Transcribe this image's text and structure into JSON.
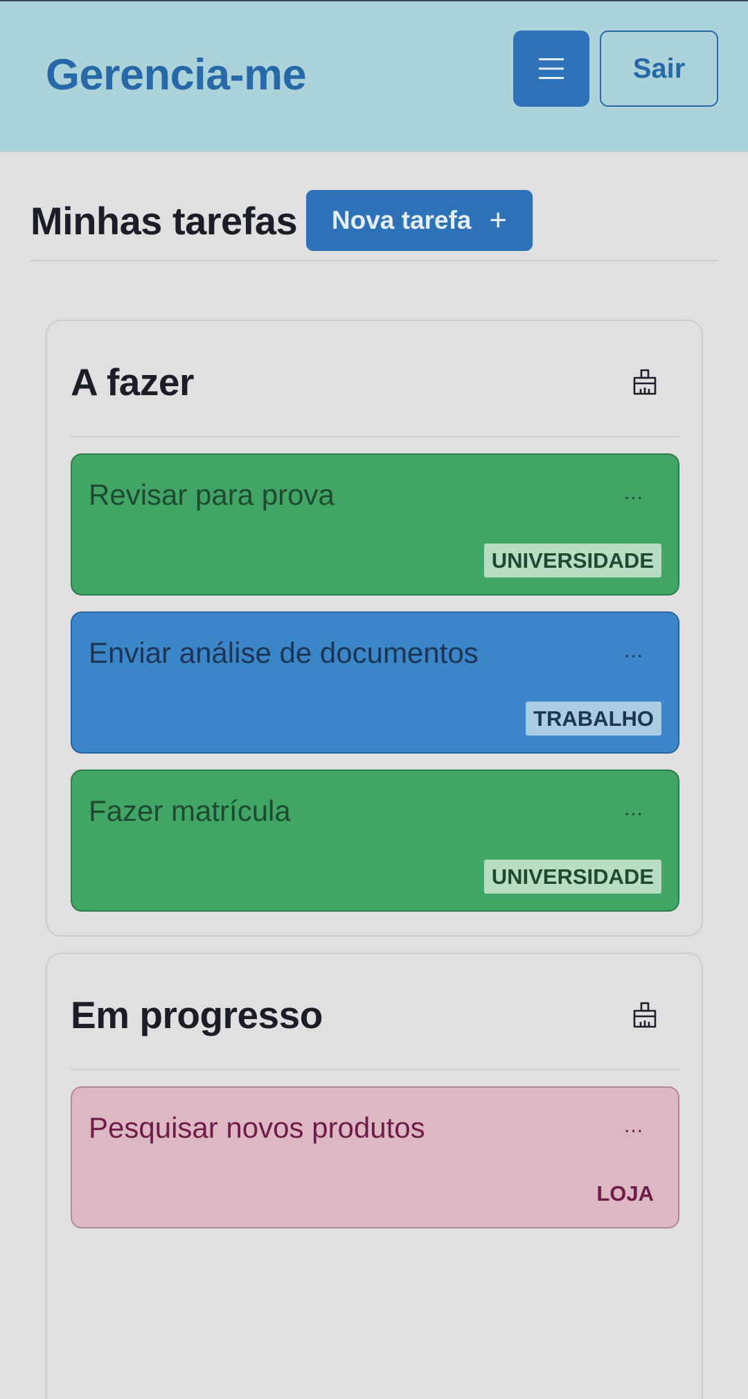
{
  "navbar": {
    "brand": "Gerencia-me",
    "menu_icon": "hamburger-icon",
    "logout_label": "Sair",
    "background": "#abd3d9",
    "accent": "#2668a8"
  },
  "page": {
    "title": "Minhas tarefas",
    "new_task_label": "Nova tarefa",
    "new_task_icon": "plus-icon"
  },
  "columns": [
    {
      "title": "A fazer",
      "clear_icon": "broom-icon",
      "cards": [
        {
          "title": "Revisar para prova",
          "menu": "...",
          "tag": "UNIVERSIDADE",
          "color": "#41a566"
        },
        {
          "title": "Enviar análise de documentos",
          "menu": "...",
          "tag": "TRABALHO",
          "color": "#3a86c8"
        },
        {
          "title": "Fazer matrícula",
          "menu": "...",
          "tag": "UNIVERSIDADE",
          "color": "#41a566"
        }
      ]
    },
    {
      "title": "Em progresso",
      "clear_icon": "broom-icon",
      "cards": [
        {
          "title": "Pesquisar novos produtos",
          "menu": "...",
          "tag": "LOJA",
          "color": "#ddb8c3"
        }
      ]
    }
  ]
}
